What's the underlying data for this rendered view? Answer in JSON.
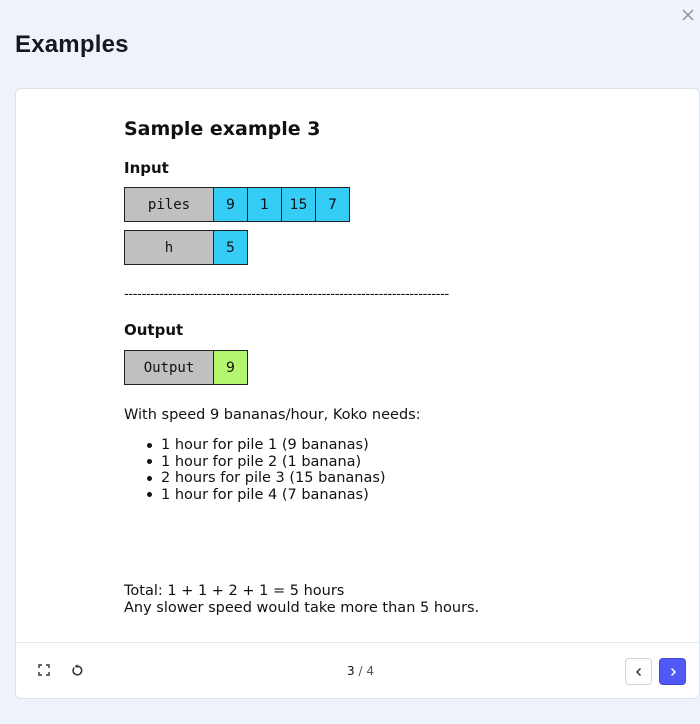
{
  "page": {
    "title": "Examples"
  },
  "example": {
    "title": "Sample example 3",
    "input_label": "Input",
    "inputs": [
      {
        "name": "piles",
        "values": [
          "9",
          "1",
          "15",
          "7"
        ]
      },
      {
        "name": "h",
        "values": [
          "5"
        ]
      }
    ],
    "divider": "--------------------------------------------------------------------------",
    "output_label": "Output",
    "output": {
      "name": "Output",
      "value": "9"
    },
    "explanation_intro": "With speed 9 bananas/hour, Koko needs:",
    "explanation_items": [
      "1 hour for pile 1 (9 bananas)",
      "1 hour for pile 2 (1 banana)",
      "2 hours for pile 3 (15 bananas)",
      "1 hour for pile 4 (7 bananas)"
    ],
    "total_line": "Total: 1 + 1 + 2 + 1 = 5 hours",
    "conclusion": "Any slower speed would take more than 5 hours."
  },
  "pager": {
    "current": "3",
    "separator": " / ",
    "total": "4"
  },
  "icons": {
    "close": "close-icon",
    "fullscreen": "expand-icon",
    "reset": "reset-icon",
    "prev": "chevron-left-icon",
    "next": "chevron-right-icon"
  },
  "colors": {
    "background": "#eef3fb",
    "input_cell": "#35ccf5",
    "output_cell": "#b2f56e",
    "name_cell": "#c0c0c0",
    "accent": "#5059f6"
  }
}
